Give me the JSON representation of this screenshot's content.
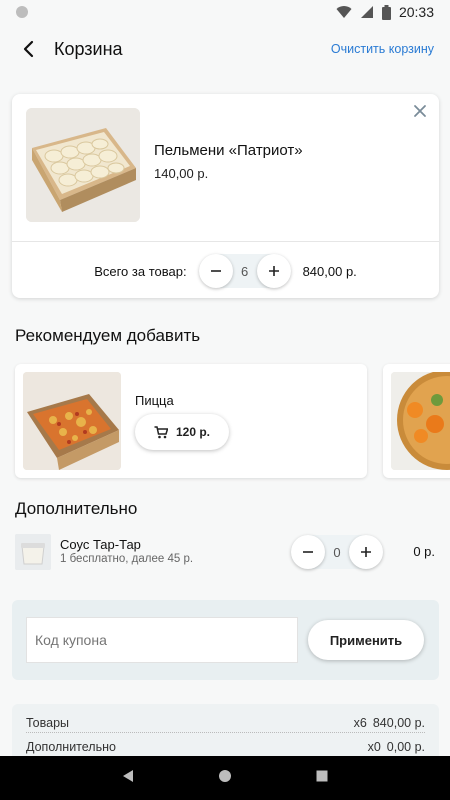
{
  "status": {
    "time": "20:33"
  },
  "appbar": {
    "title": "Корзина",
    "clear_label": "Очистить корзину"
  },
  "cart_item": {
    "name": "Пельмени «Патриот»",
    "price": "140,00 р.",
    "total_label": "Всего за товар:",
    "quantity": "6",
    "total": "840,00 р."
  },
  "recommend": {
    "title": "Рекомендуем добавить",
    "items": [
      {
        "name": "Пицца",
        "price": "120 р."
      }
    ]
  },
  "extra": {
    "title": "Дополнительно",
    "items": [
      {
        "name": "Соус Тар-Тар",
        "note": "1 бесплатно, далее 45 р.",
        "quantity": "0",
        "total": "0 р."
      }
    ]
  },
  "coupon": {
    "placeholder": "Код купона",
    "apply_label": "Применить"
  },
  "summary": {
    "rows": [
      {
        "label": "Товары",
        "qty": "х6",
        "amount": "840,00 р."
      },
      {
        "label": "Дополнительно",
        "qty": "х0",
        "amount": "0,00 р."
      }
    ]
  },
  "icons": [
    "back-arrow-icon",
    "close-icon",
    "cart-icon",
    "wifi-icon",
    "signal-icon",
    "battery-icon",
    "nav-back-icon",
    "nav-home-icon",
    "nav-recents-icon"
  ],
  "colors": {
    "accent": "#2a7bd4",
    "coupon_bg": "#e8eff1",
    "nav_bg": "#000000"
  }
}
